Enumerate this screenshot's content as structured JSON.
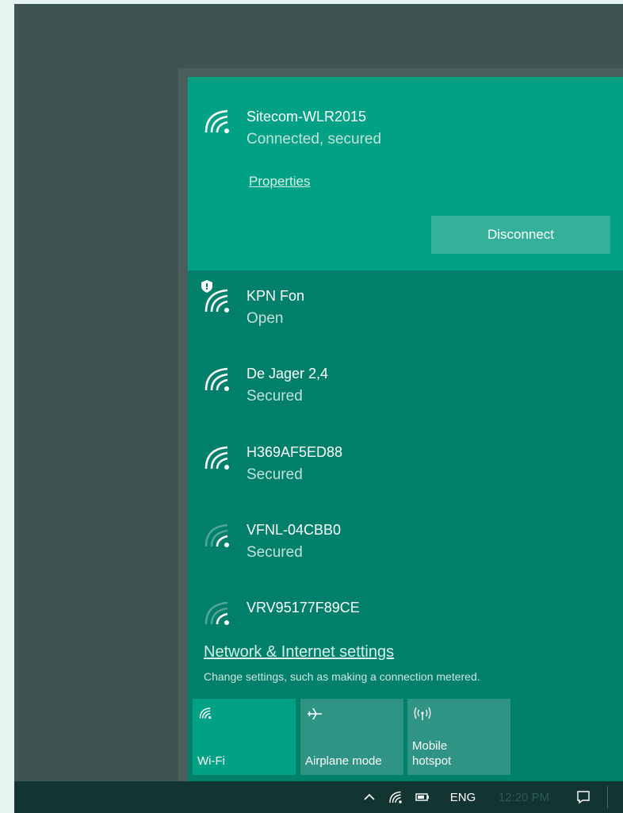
{
  "connected_network": {
    "name": "Sitecom-WLR2015",
    "status": "Connected, secured",
    "properties_label": "Properties",
    "disconnect_label": "Disconnect"
  },
  "networks": [
    {
      "name": "KPN Fon",
      "status": "Open",
      "icon": "wifi-shield-icon"
    },
    {
      "name": "De Jager 2,4",
      "status": "Secured",
      "icon": "wifi-icon"
    },
    {
      "name": "H369AF5ED88",
      "status": "Secured",
      "icon": "wifi-icon"
    },
    {
      "name": "VFNL-04CBB0",
      "status": "Secured",
      "icon": "wifi-weak-icon"
    },
    {
      "name": "VRV95177F89CE",
      "status": "",
      "icon": "wifi-weak-icon"
    }
  ],
  "settings": {
    "link_label": "Network & Internet settings",
    "description": "Change settings, such as making a connection metered."
  },
  "quick_actions": [
    {
      "label": "Wi-Fi",
      "icon": "wifi-icon",
      "active": true
    },
    {
      "label": "Airplane mode",
      "icon": "airplane-icon",
      "active": false
    },
    {
      "label": "Mobile hotspot",
      "icon": "hotspot-icon",
      "active": false
    }
  ],
  "taskbar": {
    "language": "ENG",
    "time": "12:20 PM",
    "icons": [
      "chevron-up-icon",
      "wifi-icon",
      "battery-icon",
      "action-center-icon"
    ]
  },
  "colors": {
    "desktop": "#3d5450",
    "flyout": "#007f6a",
    "selected_network": "#00a184",
    "button": "#35b199",
    "taskbar": "#123532"
  }
}
